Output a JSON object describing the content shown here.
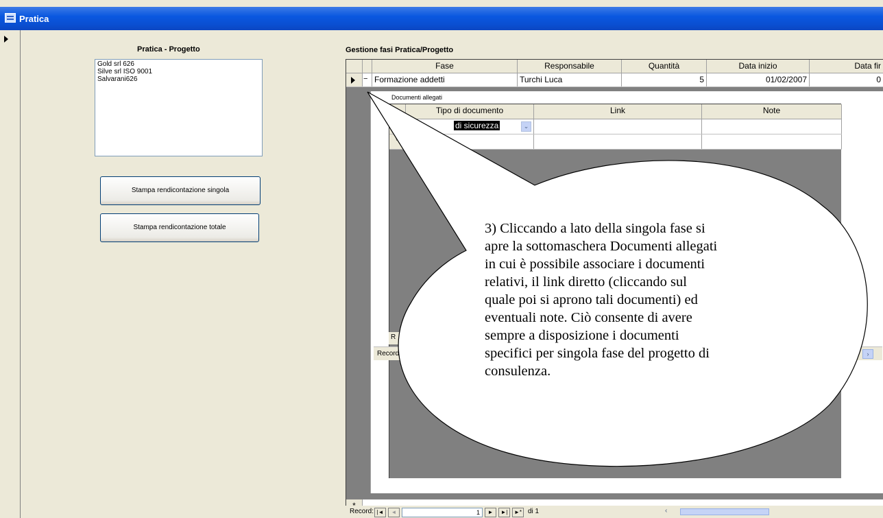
{
  "window": {
    "title": "Pratica"
  },
  "left_panel": {
    "title": "Pratica - Progetto",
    "list_items": [
      "Gold srl 626",
      "Silve srl ISO 9001",
      "Salvarani626"
    ],
    "btn_single": "Stampa rendicontazione singola",
    "btn_total": "Stampa rendicontazione totale"
  },
  "grid": {
    "title": "Gestione fasi Pratica/Progetto",
    "columns": [
      "Fase",
      "Responsabile",
      "Quantità",
      "Data inizio",
      "Data fir"
    ],
    "rows": [
      {
        "fase": "Formazione addetti",
        "responsabile": "Turchi Luca",
        "quantita": "5",
        "data_inizio": "01/02/2007",
        "data_fine": "0"
      }
    ],
    "new_row_marker": "*"
  },
  "subform": {
    "title": "Documenti allegati",
    "columns": [
      "Tipo di documento",
      "Link",
      "Note"
    ],
    "row_value": "di sicurezza",
    "new_row_marker": "*",
    "record_partial": "R",
    "record_label": "Record"
  },
  "navigator": {
    "label": "Record:",
    "current": "1",
    "of_label": "di 1"
  },
  "callout": {
    "lines": [
      "3)  Cliccando a lato della singola fase si",
      "apre la sottomaschera Documenti allegati",
      "in cui è possibile associare i documenti",
      "relativi, il link diretto (cliccando sul",
      "quale poi si aprono tali documenti) ed",
      "eventuali note. Ciò consente di avere",
      "sempre a disposizione i documenti",
      "specifici per singola fase del progetto di",
      "consulenza."
    ]
  }
}
